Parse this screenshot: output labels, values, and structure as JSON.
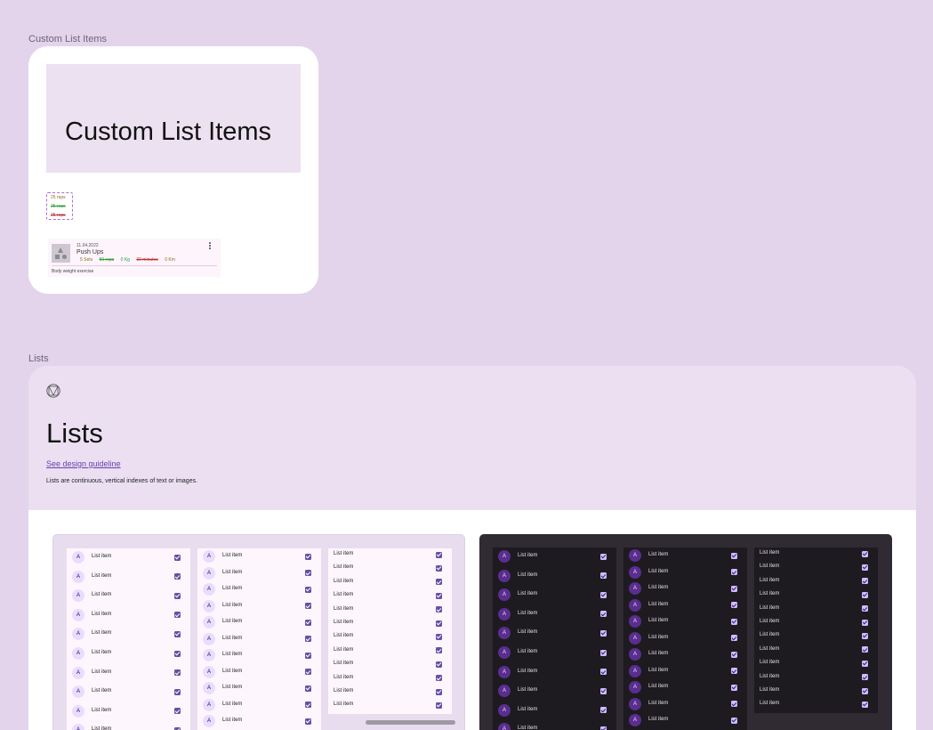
{
  "custom_list_items": {
    "frame_label": "Custom List Items",
    "hero_title": "Custom List Items",
    "reps": [
      "25 reps",
      "25 reps",
      "25 reps"
    ],
    "exercise": {
      "date": "11.04.2022",
      "title": "Push Ups",
      "stats": [
        {
          "text": "5 Sets",
          "color": "#8a6d1f"
        },
        {
          "text": "50 reps",
          "color": "#2a9d3a"
        },
        {
          "text": "0 Kg",
          "color": "#2a9d3a"
        },
        {
          "text": "30 minutes",
          "color": "#c03030"
        },
        {
          "text": "0 Km",
          "color": "#8a6d1f"
        }
      ],
      "description": "Body weight exercise"
    }
  },
  "lists": {
    "frame_label": "Lists",
    "title": "Lists",
    "guideline_link": "See design guideline",
    "description": "Lists are continuous, vertical indexes of text or images.",
    "avatar_letter": "A",
    "item_label": "List item",
    "themes": [
      "light",
      "dark"
    ],
    "accent_colors": {
      "light_checkbox": "#6750a4",
      "dark_checkbox": "#d0bcff"
    }
  }
}
